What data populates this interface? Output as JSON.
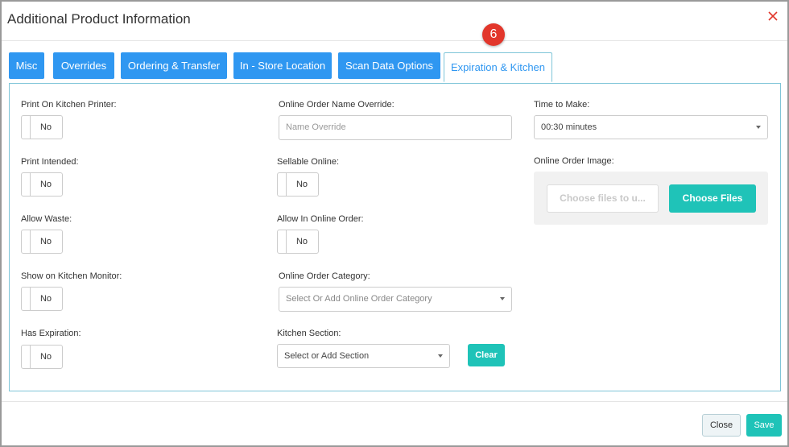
{
  "modal": {
    "title": "Additional Product Information",
    "step_badge": "6"
  },
  "tabs": [
    {
      "label": "Misc"
    },
    {
      "label": "Overrides"
    },
    {
      "label": "Ordering & Transfer"
    },
    {
      "label": "In - Store Location"
    },
    {
      "label": "Scan Data Options"
    },
    {
      "label": "Expiration & Kitchen",
      "active": true
    }
  ],
  "left_column": {
    "print_on_kitchen_printer": {
      "label": "Print On Kitchen Printer:",
      "value": "No"
    },
    "print_intended": {
      "label": "Print Intended:",
      "value": "No"
    },
    "allow_waste": {
      "label": "Allow Waste:",
      "value": "No"
    },
    "show_on_kitchen_monitor": {
      "label": "Show on Kitchen Monitor:",
      "value": "No"
    },
    "has_expiration": {
      "label": "Has Expiration:",
      "value": "No"
    }
  },
  "middle_column": {
    "online_order_name_override": {
      "label": "Online Order Name Override:",
      "placeholder": "Name Override"
    },
    "sellable_online": {
      "label": "Sellable Online:",
      "value": "No"
    },
    "allow_in_online_order": {
      "label": "Allow In Online Order:",
      "value": "No"
    },
    "online_order_category": {
      "label": "Online Order Category:",
      "value": "Select Or Add Online Order Category"
    },
    "kitchen_section": {
      "label": "Kitchen Section:",
      "value": "Select or Add Section",
      "clear_label": "Clear"
    }
  },
  "right_column": {
    "time_to_make": {
      "label": "Time to Make:",
      "value": "00:30 minutes"
    },
    "online_order_image": {
      "label": "Online Order Image:",
      "file_placeholder": "Choose files to u...",
      "choose_label": "Choose Files"
    }
  },
  "footer": {
    "close_label": "Close",
    "save_label": "Save"
  },
  "colors": {
    "tab_blue": "#2f97f1",
    "teal": "#1fc3b8",
    "badge_red": "#e2362b",
    "panel_border": "#7fc5d8"
  }
}
